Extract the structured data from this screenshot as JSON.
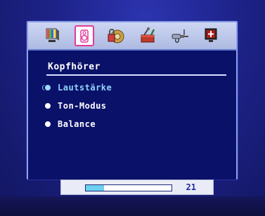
{
  "osd": {
    "tabs": [
      {
        "name": "picture",
        "icon": "tv-icon",
        "active": false
      },
      {
        "name": "audio",
        "icon": "speaker-icon",
        "active": true
      },
      {
        "name": "lock",
        "icon": "lock-icon",
        "active": false
      },
      {
        "name": "tools",
        "icon": "toolbox-icon",
        "active": false
      },
      {
        "name": "input",
        "icon": "plug-icon",
        "active": false
      },
      {
        "name": "setup",
        "icon": "monitor-cross-icon",
        "active": false
      }
    ],
    "menu": {
      "title": "Kopfhörer",
      "items": [
        {
          "label": "Lautstärke",
          "selected": true
        },
        {
          "label": "Ton-Modus",
          "selected": false
        },
        {
          "label": "Balance",
          "selected": false
        }
      ]
    }
  },
  "slider": {
    "value": "21",
    "fill_percent": 21
  },
  "colors": {
    "background": "#1a1e7a",
    "menu_bg": "#0a1168",
    "selected_text": "#8fd4ff",
    "active_tab_border": "#e23a9a",
    "slider_fill": "#6cd0f0"
  }
}
